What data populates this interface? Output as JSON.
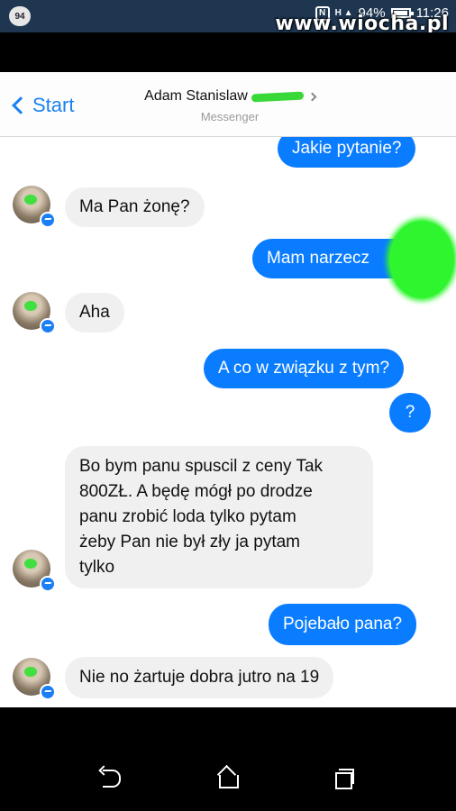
{
  "status_bar": {
    "notification_count": "94",
    "battery": "94%",
    "time": "11:26",
    "watermark": "www.wiocha.pl",
    "icons": [
      "nfc-icon",
      "signal-icon",
      "battery-icon"
    ]
  },
  "header": {
    "back_label": "Start",
    "contact_name": "Adam Stanislaw",
    "contact_subtitle": "Messenger",
    "accent_color": "#0a7cff"
  },
  "messages": [
    {
      "from": "me",
      "text": "Jakie pytanie?"
    },
    {
      "from": "them",
      "text": "Ma Pan żonę?"
    },
    {
      "from": "me",
      "text": "Mam narzecz"
    },
    {
      "from": "them",
      "text": "Aha"
    },
    {
      "from": "me",
      "text": "A co w związku z tym?"
    },
    {
      "from": "me",
      "text": "?"
    },
    {
      "from": "them",
      "lines": [
        "Bo bym panu spuscil z ceny Tak",
        "800ZŁ. A będę mógł po drodze",
        "panu zrobić loda tylko pytam",
        "żeby Pan nie był zły ja pytam",
        "tylko"
      ]
    },
    {
      "from": "me",
      "text": "Pojebało pana?"
    },
    {
      "from": "them",
      "text": "Nie no żartuje dobra jutro na 19"
    }
  ],
  "navigation": [
    "back-nav-icon",
    "home-nav-icon",
    "recents-nav-icon"
  ]
}
